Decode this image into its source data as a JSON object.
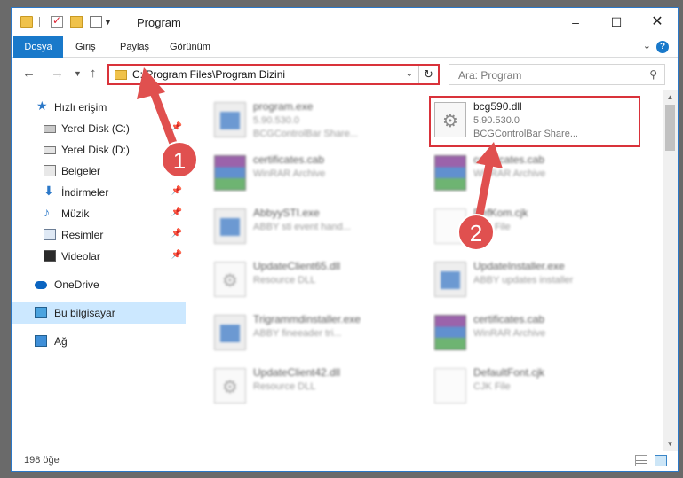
{
  "window": {
    "title": "Program",
    "min": "–",
    "max": "☐",
    "close": "✕"
  },
  "ribbon": {
    "tabs": [
      "Dosya",
      "Giriş",
      "Paylaş",
      "Görünüm"
    ],
    "help": "?"
  },
  "address": {
    "path": "C:\\Program Files\\Program Dizini",
    "refresh": "↻"
  },
  "search": {
    "placeholder": "Ara: Program"
  },
  "sidebar": {
    "items": [
      {
        "label": "Hızlı erişim",
        "icon": "star-icon"
      },
      {
        "label": "Yerel Disk (C:)",
        "icon": "drive-icon",
        "pinned": true
      },
      {
        "label": "Yerel Disk (D:)",
        "icon": "drive-icon"
      },
      {
        "label": "Belgeler",
        "icon": "documents-icon"
      },
      {
        "label": "İndirmeler",
        "icon": "download-icon",
        "pinned": true
      },
      {
        "label": "Müzik",
        "icon": "music-icon",
        "pinned": true
      },
      {
        "label": "Resimler",
        "icon": "pictures-icon",
        "pinned": true
      },
      {
        "label": "Videolar",
        "icon": "videos-icon",
        "pinned": true
      },
      {
        "label": "OneDrive",
        "icon": "onedrive-icon"
      },
      {
        "label": "Bu bilgisayar",
        "icon": "computer-icon",
        "selected": true
      },
      {
        "label": "Ağ",
        "icon": "network-icon"
      }
    ]
  },
  "files": [
    {
      "name": "program.exe",
      "line1": "5.90.530.0",
      "line2": "BCGControlBar Share...",
      "kind": "exe"
    },
    {
      "name": "bcg590.dll",
      "line1": "5.90.530.0",
      "line2": "BCGControlBar Share...",
      "kind": "dll",
      "highlighted": true
    },
    {
      "name": "certificates.cab",
      "line1": "WinRAR Archive",
      "line2": "",
      "kind": "rar"
    },
    {
      "name": "certificates.cab",
      "line1": "WinRAR Archive",
      "line2": "",
      "kind": "rar"
    },
    {
      "name": "AbbyySTI.exe",
      "line1": "ABBY sti event hand...",
      "line2": "",
      "kind": "exe"
    },
    {
      "name": "DefKom.cjk",
      "line1": "CJK File",
      "line2": "",
      "kind": "cjk"
    },
    {
      "name": "UpdateClient65.dll",
      "line1": "Resource DLL",
      "line2": "",
      "kind": "dll"
    },
    {
      "name": "UpdateInstaller.exe",
      "line1": "ABBY updates installer",
      "line2": "",
      "kind": "exe"
    },
    {
      "name": "Trigrammdinstaller.exe",
      "line1": "ABBY fineeader tri...",
      "line2": "",
      "kind": "exe"
    },
    {
      "name": "certificates.cab",
      "line1": "WinRAR Archive",
      "line2": "",
      "kind": "rar"
    },
    {
      "name": "UpdateClient42.dll",
      "line1": "Resource DLL",
      "line2": "",
      "kind": "dll"
    },
    {
      "name": "DefaultFont.cjk",
      "line1": "CJK File",
      "line2": "",
      "kind": "cjk"
    }
  ],
  "annotations": {
    "step1": "1",
    "step2": "2",
    "color": "#e0504f"
  },
  "status": {
    "count": "198 öğe"
  }
}
